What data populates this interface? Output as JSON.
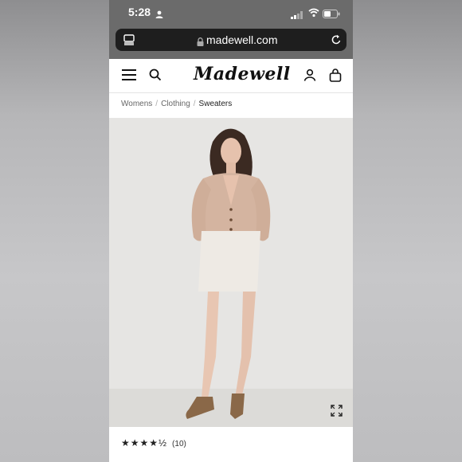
{
  "status_bar": {
    "time": "5:28"
  },
  "browser": {
    "url": "madewell.com"
  },
  "nav": {
    "logo_text": "Madewell"
  },
  "breadcrumb": [
    {
      "label": "Womens"
    },
    {
      "label": "Clothing"
    },
    {
      "label": "Sweaters"
    }
  ],
  "product": {
    "image_icons": [
      "expand-icon"
    ],
    "rating": {
      "stars_text": "★★★★½",
      "value": 4.5,
      "count_label": "(10)"
    }
  },
  "colors": {
    "status_bar_bg": "#6b6b6b",
    "url_bar_bg": "#1e1e1e",
    "page_bg": "#ffffff",
    "image_bg": "#e5e4e2"
  }
}
